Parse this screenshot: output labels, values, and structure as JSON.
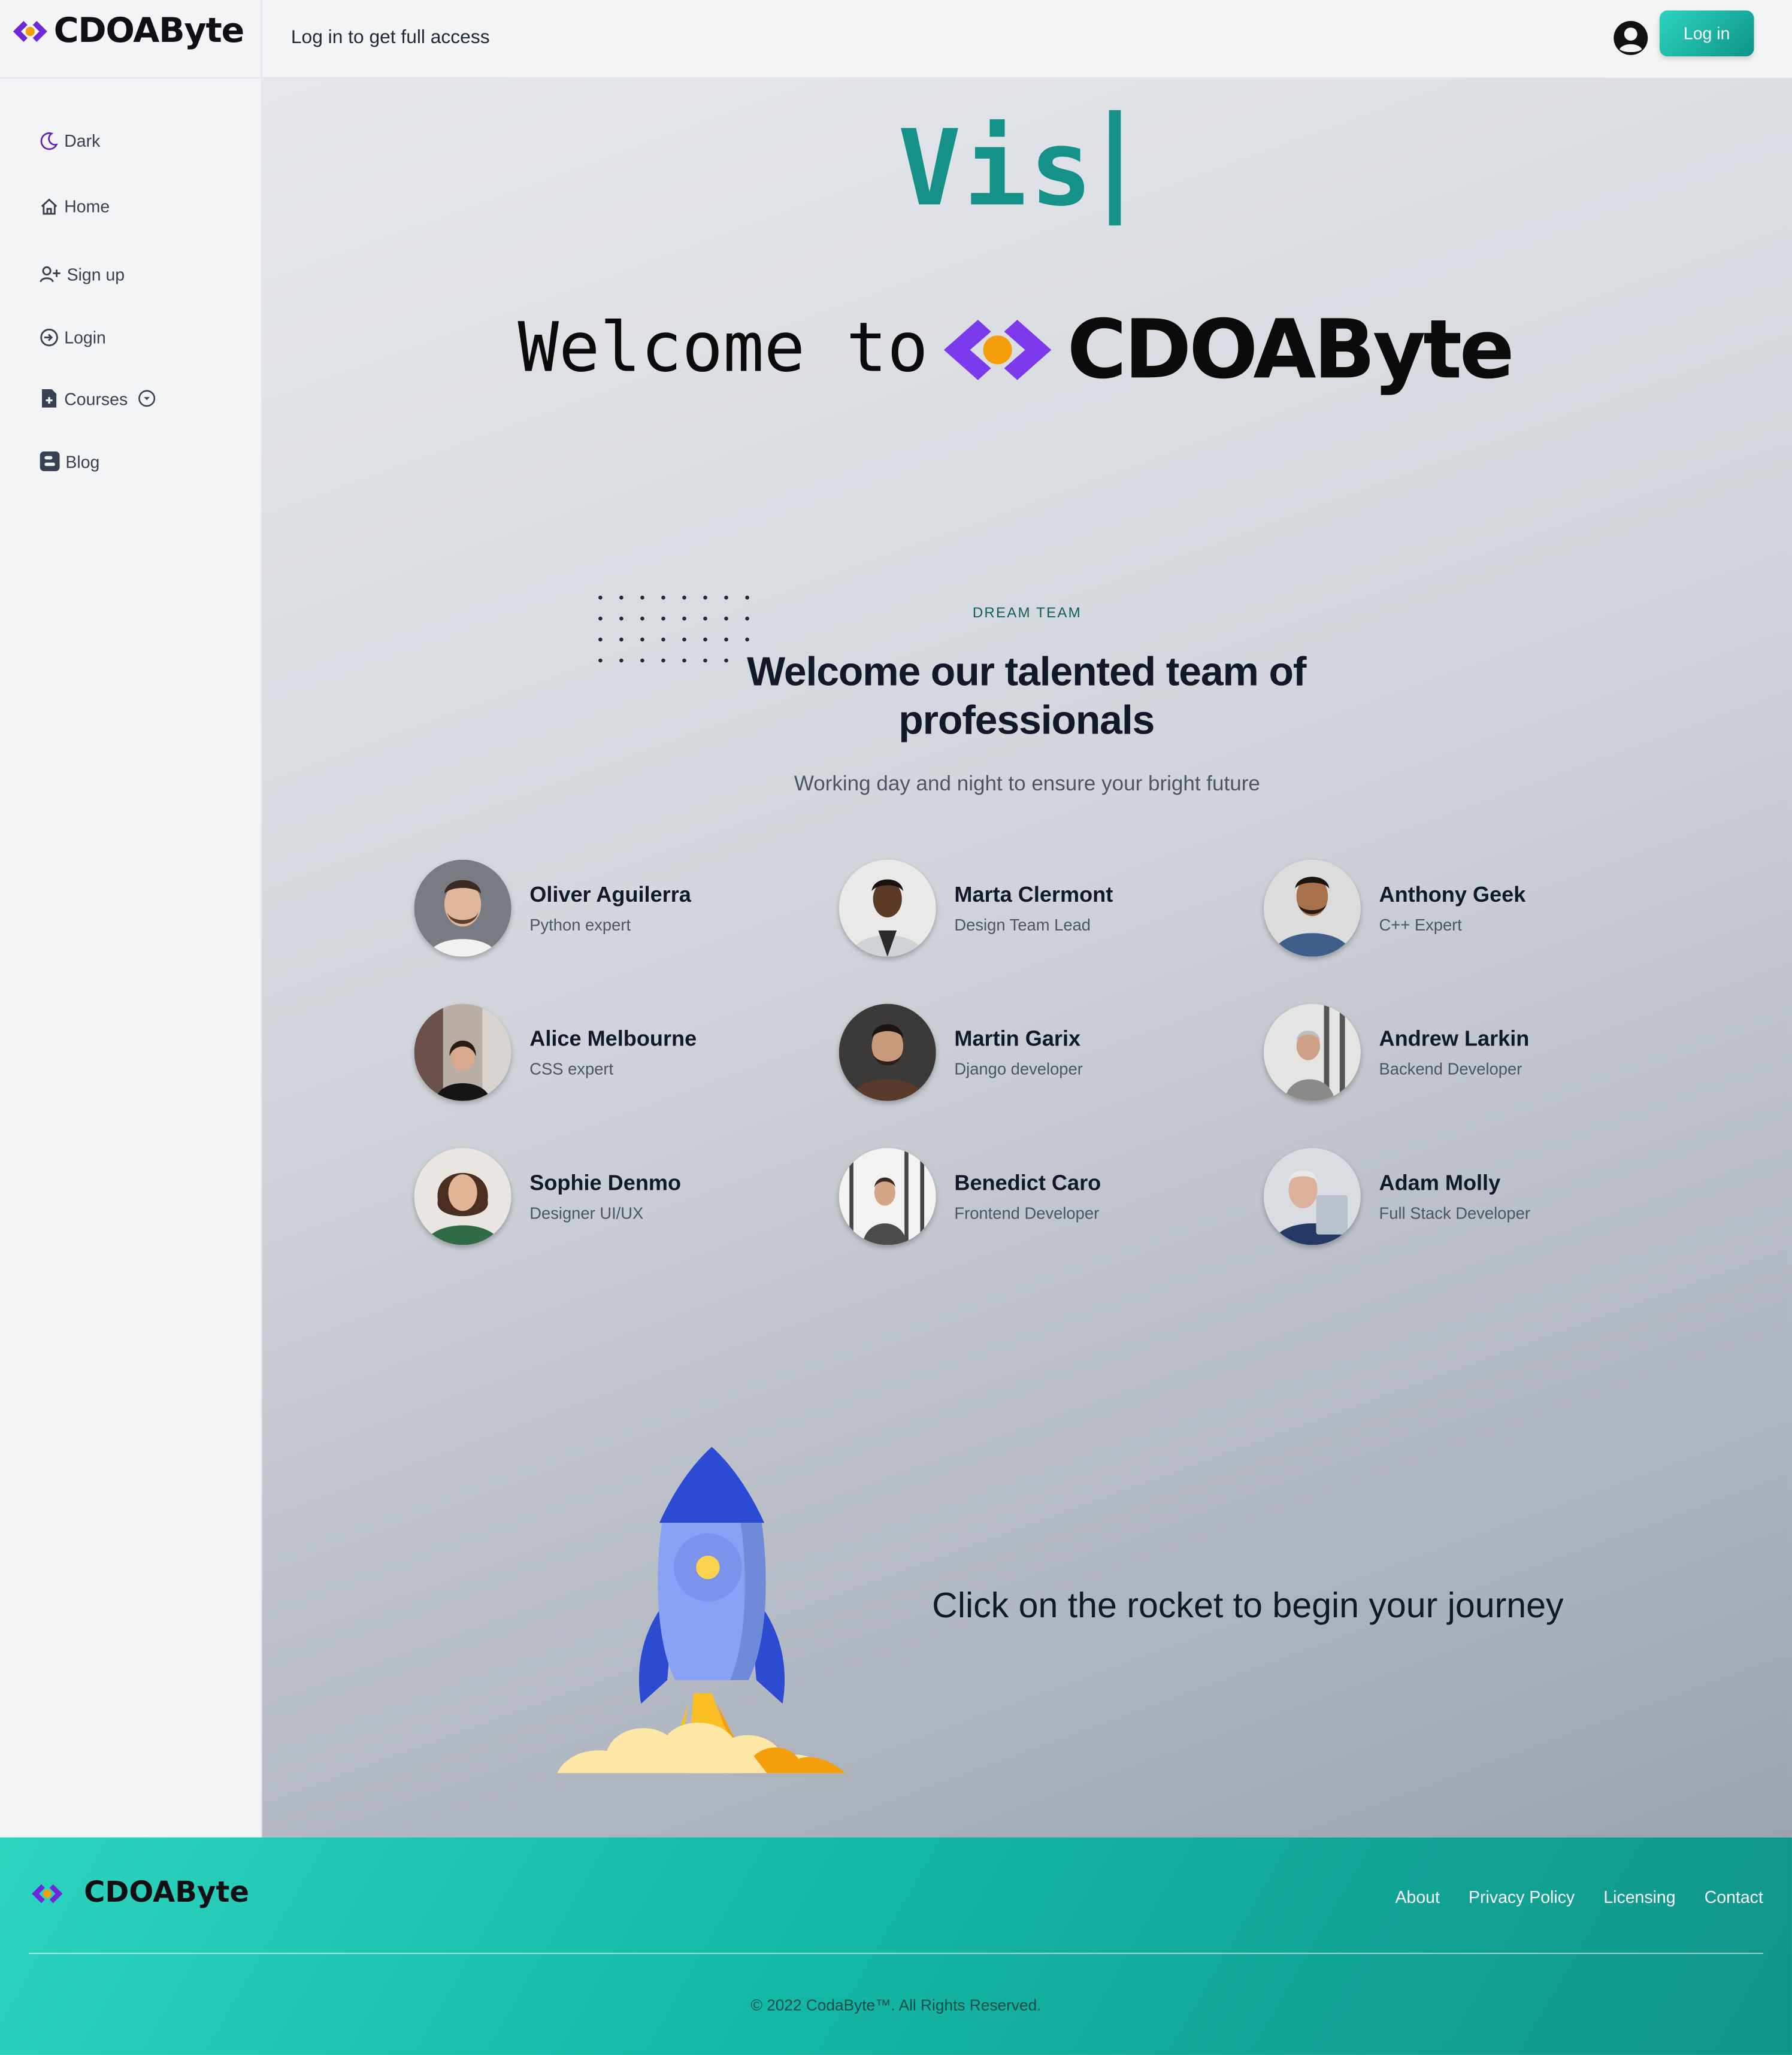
{
  "brand": {
    "name": "CDOAByte",
    "accent_purple": "#6d28d9",
    "accent_orange": "#f59e0b",
    "accent_teal": "#14b8a6"
  },
  "topbar": {
    "notice": "Log in to get full access",
    "login_label": "Log in",
    "user_icon": "user-circle-icon"
  },
  "sidebar": {
    "items": [
      {
        "label": "Dark",
        "icon": "moon-icon"
      },
      {
        "label": "Home",
        "icon": "home-icon"
      },
      {
        "label": "Sign up",
        "icon": "user-plus-icon"
      },
      {
        "label": "Login",
        "icon": "login-icon"
      },
      {
        "label": "Courses",
        "icon": "file-plus-icon"
      },
      {
        "label": "Blog",
        "icon": "blogger-icon"
      }
    ]
  },
  "hero": {
    "typing_text": "Vis",
    "welcome_text": "Welcome to",
    "logo_text": "CDOAByte"
  },
  "team": {
    "eyebrow": "DREAM TEAM",
    "title": "Welcome our talented team of professionals",
    "subtitle": "Working day and night to ensure your bright future",
    "members": [
      {
        "name": "Oliver Aguilerra",
        "role": "Python expert"
      },
      {
        "name": "Marta Clermont",
        "role": "Design Team Lead"
      },
      {
        "name": "Anthony Geek",
        "role": "C++ Expert"
      },
      {
        "name": "Alice Melbourne",
        "role": "CSS expert"
      },
      {
        "name": "Martin Garix",
        "role": "Django developer"
      },
      {
        "name": "Andrew Larkin",
        "role": "Backend Developer"
      },
      {
        "name": "Sophie Denmo",
        "role": "Designer UI/UX"
      },
      {
        "name": "Benedict Caro",
        "role": "Frontend Developer"
      },
      {
        "name": "Adam Molly",
        "role": "Full Stack Developer"
      }
    ]
  },
  "journey": {
    "text": "Click on the rocket to begin your journey"
  },
  "footer": {
    "brand": "CDOAByte",
    "links": [
      "About",
      "Privacy Policy",
      "Licensing",
      "Contact"
    ],
    "copyright": "© 2022 CodaByte™. All Rights Reserved."
  }
}
